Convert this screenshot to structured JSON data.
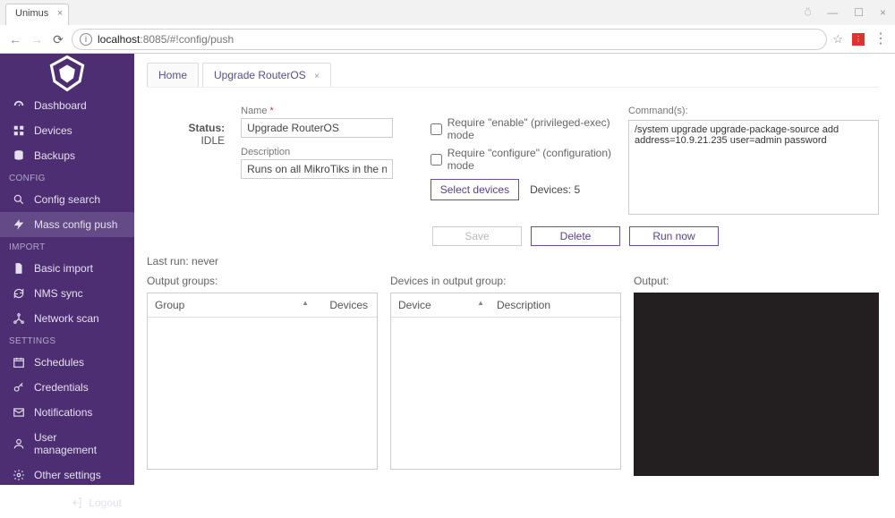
{
  "browser": {
    "tab_title": "Unimus",
    "url_host": "localhost",
    "url_port_path": ":8085/#!config/push"
  },
  "sidebar": {
    "main": [
      {
        "label": "Dashboard"
      },
      {
        "label": "Devices"
      },
      {
        "label": "Backups"
      }
    ],
    "config_head": "CONFIG",
    "config": [
      {
        "label": "Config search"
      },
      {
        "label": "Mass config push"
      }
    ],
    "import_head": "IMPORT",
    "import": [
      {
        "label": "Basic import"
      },
      {
        "label": "NMS sync"
      },
      {
        "label": "Network scan"
      }
    ],
    "settings_head": "SETTINGS",
    "settings": [
      {
        "label": "Schedules"
      },
      {
        "label": "Credentials"
      },
      {
        "label": "Notifications"
      },
      {
        "label": "User management"
      },
      {
        "label": "Other settings"
      }
    ],
    "logout": "Logout"
  },
  "tabs": {
    "home": "Home",
    "upgrade": "Upgrade RouterOS"
  },
  "status": {
    "label": "Status:",
    "value": "IDLE"
  },
  "form": {
    "name_label": "Name",
    "name_value": "Upgrade RouterOS",
    "desc_label": "Description",
    "desc_value": "Runs on all MikroTiks in the network",
    "req_enable": "Require \"enable\" (privileged-exec) mode",
    "req_configure": "Require \"configure\" (configuration) mode",
    "select_devices": "Select devices",
    "devices_count": "Devices: 5",
    "commands_label": "Command(s):",
    "commands_value": "/system upgrade upgrade-package-source add address=10.9.21.235 user=admin password"
  },
  "actions": {
    "save": "Save",
    "delete": "Delete",
    "run": "Run now"
  },
  "last_run": "Last run: never",
  "panels": {
    "output_groups": "Output groups:",
    "group_col": "Group",
    "devices_col": "Devices",
    "devices_in_group": "Devices in output group:",
    "device_col": "Device",
    "description_col": "Description",
    "output": "Output:"
  }
}
